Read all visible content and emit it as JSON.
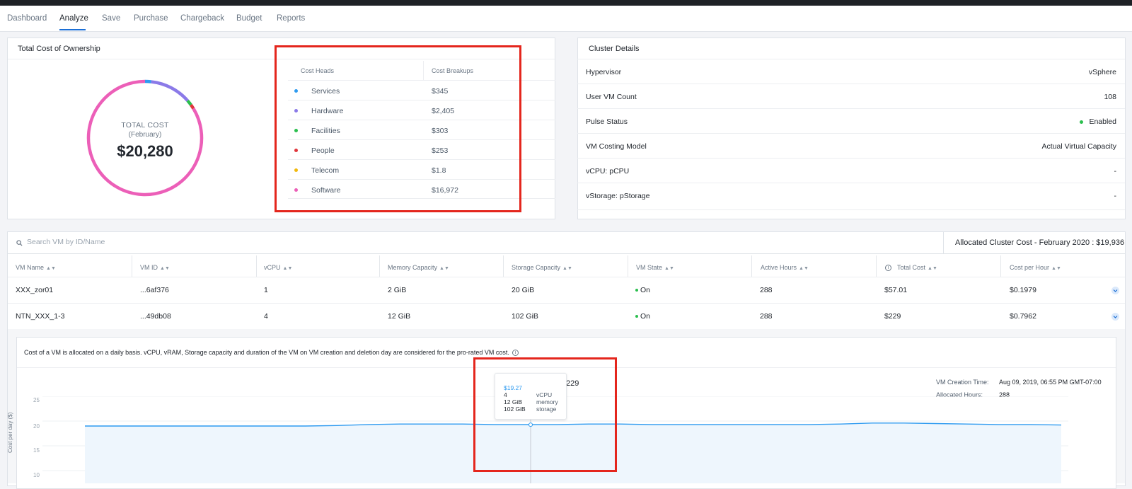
{
  "nav": {
    "items": [
      {
        "label": "Dashboard"
      },
      {
        "label": "Analyze"
      },
      {
        "label": "Save"
      },
      {
        "label": "Purchase"
      },
      {
        "label": "Chargeback"
      },
      {
        "label": "Budget"
      },
      {
        "label": "Reports"
      }
    ],
    "active": "Analyze"
  },
  "tco": {
    "title": "Total Cost of Ownership",
    "donut": {
      "label": "TOTAL COST",
      "period": "(February)",
      "total": "$20,280"
    },
    "table": {
      "headers": [
        "Cost Heads",
        "Cost Breakups"
      ],
      "rows": [
        {
          "name": "Services",
          "value": "$345",
          "color": "#2f9bf0",
          "amount": 345
        },
        {
          "name": "Hardware",
          "value": "$2,405",
          "color": "#8b7ae8",
          "amount": 2405
        },
        {
          "name": "Facilities",
          "value": "$303",
          "color": "#2bbf4e",
          "amount": 303
        },
        {
          "name": "People",
          "value": "$253",
          "color": "#e0363c",
          "amount": 253
        },
        {
          "name": "Telecom",
          "value": "$1.8",
          "color": "#f2b90d",
          "amount": 1.8
        },
        {
          "name": "Software",
          "value": "$16,972",
          "color": "#ec5fb8",
          "amount": 16972
        }
      ]
    }
  },
  "cluster": {
    "title": "Cluster Details",
    "rows": [
      {
        "label": "Hypervisor",
        "value": "vSphere"
      },
      {
        "label": "User VM Count",
        "value": "108"
      },
      {
        "label": "Pulse Status",
        "value": "Enabled"
      },
      {
        "label": "VM Costing Model",
        "value": "Actual Virtual Capacity"
      },
      {
        "label": "vCPU: pCPU",
        "value": "-"
      },
      {
        "label": "vStorage: pStorage",
        "value": "-"
      }
    ]
  },
  "vm_table": {
    "search_placeholder": "Search VM by ID/Name",
    "allocated": "Allocated Cluster Cost - February 2020 : $19,936",
    "columns": [
      "VM Name",
      "VM ID",
      "vCPU",
      "Memory Capacity",
      "Storage Capacity",
      "VM State",
      "Active Hours",
      "Total Cost",
      "Cost per Hour"
    ],
    "rows": [
      {
        "name": "XXX_zor01",
        "id": "...6af376",
        "vcpu": "1",
        "memory": "2 GiB",
        "storage": "20 GiB",
        "state": "On",
        "hours": "288",
        "total": "$57.01",
        "per_hour": "$0.1979"
      },
      {
        "name": "NTN_XXX_1-3",
        "id": "...49db08",
        "vcpu": "4",
        "memory": "12 GiB",
        "storage": "102 GiB",
        "state": "On",
        "hours": "288",
        "total": "$229",
        "per_hour": "$0.7962"
      }
    ]
  },
  "detail": {
    "note": "Cost of a VM is allocated on a daily basis. vCPU, vRAM, Storage capacity and duration of the VM on VM creation and deletion day are considered for the pro-rated VM cost.",
    "partial_value": "229",
    "creation_label": "VM Creation Time:",
    "creation_value": "Aug 09, 2019, 06:55 PM GMT-07:00",
    "hours_label": "Allocated Hours:",
    "hours_value": "288",
    "tooltip": {
      "cost": "$19.27",
      "vcpu_value": "4",
      "vcpu_label": "vCPU",
      "memory_value": "12 GiB",
      "memory_label": "memory",
      "storage_value": "102 GiB",
      "storage_label": "storage"
    }
  },
  "chart_data": {
    "type": "area",
    "ylabel": "Cost per day ($)",
    "yticks": [
      25,
      20,
      15,
      10
    ],
    "series": [
      {
        "values": [
          19.0,
          19.0,
          19.0,
          19.0,
          19.0,
          19.0,
          19.0,
          19.0,
          19.1,
          19.3,
          19.4,
          19.4,
          19.4,
          19.3,
          19.3,
          19.3,
          19.4,
          19.4,
          19.3,
          19.3,
          19.3,
          19.3,
          19.3,
          19.3,
          19.4,
          19.6,
          19.6,
          19.5,
          19.4,
          19.3,
          19.3,
          19.2
        ]
      }
    ],
    "highlight_value": 19.27,
    "line_color": "#2f9bf0",
    "fill_color": "#eef6fd"
  }
}
